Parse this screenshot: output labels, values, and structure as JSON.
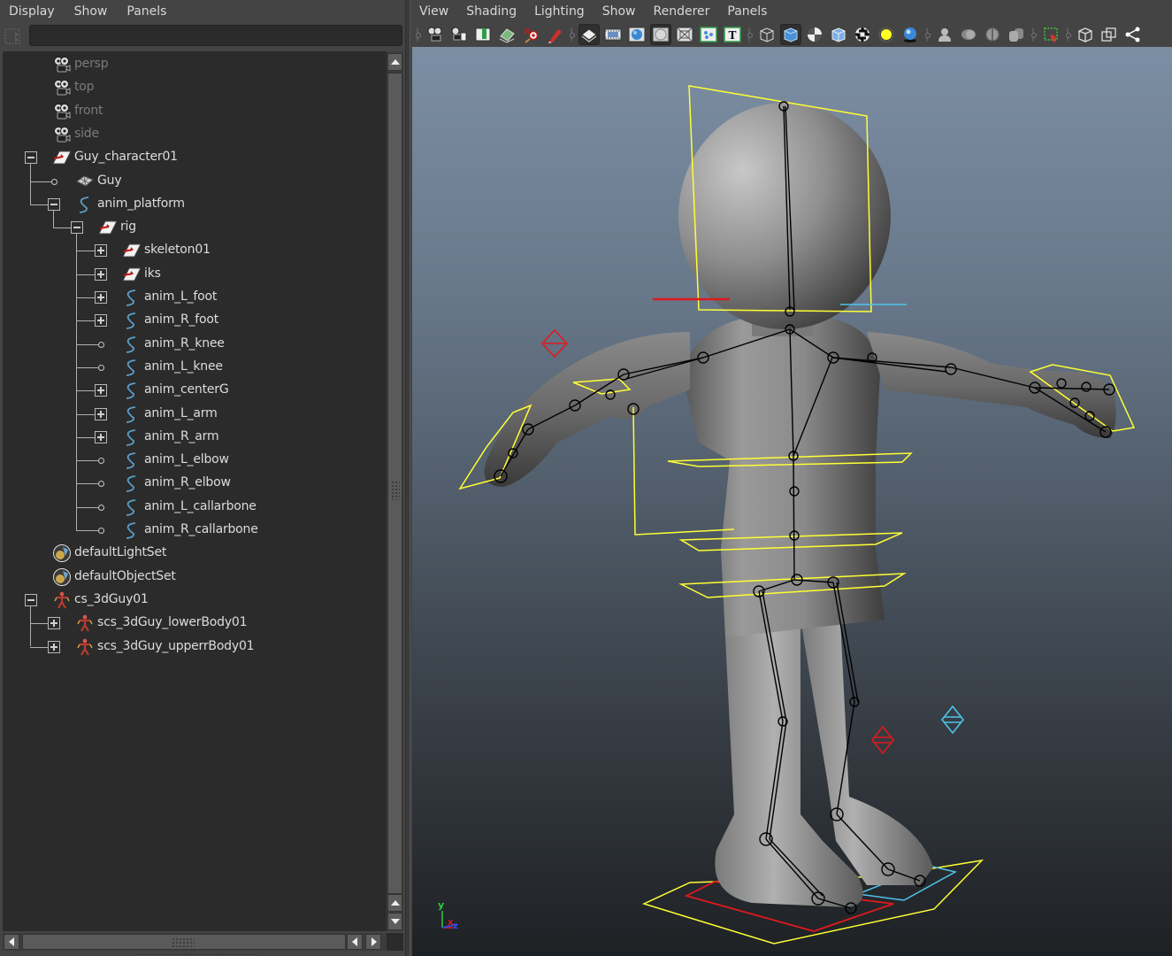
{
  "outliner": {
    "menu": [
      "Display",
      "Show",
      "Panels"
    ],
    "filter": {
      "value": "",
      "placeholder": ""
    },
    "items": [
      {
        "label": "persp",
        "icon": "camera-icon",
        "depth": 0,
        "expander": "none",
        "dimmed": true
      },
      {
        "label": "top",
        "icon": "camera-icon",
        "depth": 0,
        "expander": "none",
        "dimmed": true
      },
      {
        "label": "front",
        "icon": "camera-icon",
        "depth": 0,
        "expander": "none",
        "dimmed": true
      },
      {
        "label": "side",
        "icon": "camera-icon",
        "depth": 0,
        "expander": "none",
        "dimmed": true
      },
      {
        "label": "Guy_character01",
        "icon": "transform-group-icon",
        "depth": 0,
        "expander": "minus",
        "dimmed": false
      },
      {
        "label": "Guy",
        "icon": "mesh-icon",
        "depth": 1,
        "expander": "leaf",
        "dimmed": false
      },
      {
        "label": "anim_platform",
        "icon": "nurbs-curve-icon",
        "depth": 1,
        "expander": "minus",
        "dimmed": false
      },
      {
        "label": "rig",
        "icon": "transform-group-icon",
        "depth": 2,
        "expander": "minus",
        "dimmed": false
      },
      {
        "label": "skeleton01",
        "icon": "transform-group-icon",
        "depth": 3,
        "expander": "plus",
        "dimmed": false
      },
      {
        "label": "iks",
        "icon": "transform-group-icon",
        "depth": 3,
        "expander": "plus",
        "dimmed": false
      },
      {
        "label": "anim_L_foot",
        "icon": "nurbs-curve-icon",
        "depth": 3,
        "expander": "plus",
        "dimmed": false
      },
      {
        "label": "anim_R_foot",
        "icon": "nurbs-curve-icon",
        "depth": 3,
        "expander": "plus",
        "dimmed": false
      },
      {
        "label": "anim_R_knee",
        "icon": "nurbs-curve-icon",
        "depth": 3,
        "expander": "leaf",
        "dimmed": false
      },
      {
        "label": "anim_L_knee",
        "icon": "nurbs-curve-icon",
        "depth": 3,
        "expander": "leaf",
        "dimmed": false
      },
      {
        "label": "anim_centerG",
        "icon": "nurbs-curve-icon",
        "depth": 3,
        "expander": "plus",
        "dimmed": false
      },
      {
        "label": "anim_L_arm",
        "icon": "nurbs-curve-icon",
        "depth": 3,
        "expander": "plus",
        "dimmed": false
      },
      {
        "label": "anim_R_arm",
        "icon": "nurbs-curve-icon",
        "depth": 3,
        "expander": "plus",
        "dimmed": false
      },
      {
        "label": "anim_L_elbow",
        "icon": "nurbs-curve-icon",
        "depth": 3,
        "expander": "leaf",
        "dimmed": false
      },
      {
        "label": "anim_R_elbow",
        "icon": "nurbs-curve-icon",
        "depth": 3,
        "expander": "leaf",
        "dimmed": false
      },
      {
        "label": "anim_L_callarbone",
        "icon": "nurbs-curve-icon",
        "depth": 3,
        "expander": "leaf",
        "dimmed": false
      },
      {
        "label": "anim_R_callarbone",
        "icon": "nurbs-curve-icon",
        "depth": 3,
        "expander": "leaf",
        "dimmed": false
      },
      {
        "label": "defaultLightSet",
        "icon": "object-set-icon",
        "depth": 0,
        "expander": "none",
        "dimmed": false
      },
      {
        "label": "defaultObjectSet",
        "icon": "object-set-icon",
        "depth": 0,
        "expander": "none",
        "dimmed": false
      },
      {
        "label": "cs_3dGuy01",
        "icon": "character-set-icon",
        "depth": 0,
        "expander": "minus",
        "dimmed": false
      },
      {
        "label": "scs_3dGuy_lowerBody01",
        "icon": "character-set-icon",
        "depth": 1,
        "expander": "plus",
        "dimmed": false
      },
      {
        "label": "scs_3dGuy_upperrBody01",
        "icon": "character-set-icon",
        "depth": 1,
        "expander": "plus",
        "dimmed": false
      }
    ]
  },
  "viewport": {
    "menu": [
      "View",
      "Shading",
      "Lighting",
      "Show",
      "Renderer",
      "Panels"
    ],
    "toolbar_groups": [
      [
        "select-camera-icon",
        "camera-attributes-icon",
        "bookmarks-icon",
        "image-plane-icon",
        "2d-pan-zoom-icon",
        "grease-pencil-icon"
      ],
      [
        "grid-icon",
        "film-gate-icon",
        "resolution-gate-icon",
        "gate-mask-icon",
        "field-chart-icon",
        "safe-action-icon",
        "safe-title-icon"
      ],
      [
        "wireframe-icon",
        "smooth-shade-all-icon",
        "wireframe-on-shaded-icon",
        "xray-icon",
        "default-material-icon",
        "use-all-lights-icon",
        "shadows-icon"
      ],
      [
        "screen-space-ao-icon",
        "motion-blur-icon",
        "multisample-aa-icon",
        "depth-of-field-icon"
      ],
      [
        "isolate-select-icon"
      ],
      [
        "xray-active-components-icon",
        "xray-joints-icon",
        "hypershade-graph-icon"
      ]
    ],
    "toolbar_active": [
      "grid-icon",
      "gate-mask-icon",
      "smooth-shade-all-icon"
    ],
    "axis": {
      "y": "y",
      "x": "x",
      "z": "z"
    },
    "colors": {
      "yellow_controls": "#ffff33",
      "red_control": "#e0191e",
      "cyan_control": "#4fc3ea",
      "joints": "#000000"
    }
  }
}
